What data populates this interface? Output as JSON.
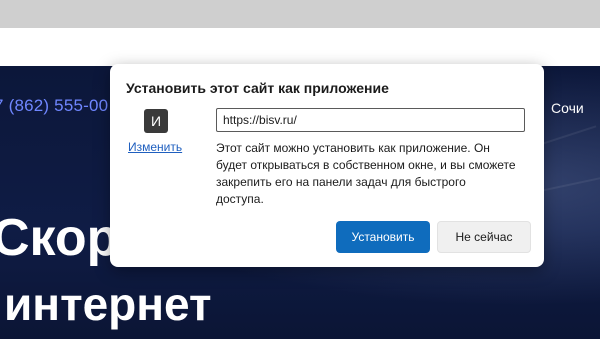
{
  "browser": {
    "top_strip_color": "#cfcfcf",
    "address_strip_color": "#ffffff"
  },
  "website": {
    "phone": "7 (862) 555-00",
    "city": "Сочи",
    "headline_line1": "Скоро",
    "headline_line2": "интернет",
    "accent_color": "#6f86ff",
    "background_color": "#0f1a3c"
  },
  "dialog": {
    "title": "Установить этот сайт как приложение",
    "app_icon_letter": "И",
    "edit_link": "Изменить",
    "url_value": "https://bisv.ru/",
    "description": "Этот сайт можно установить как приложение. Он будет открываться в собственном окне, и вы сможете закрепить его на панели задач для быстрого доступа.",
    "install_button": "Установить",
    "not_now_button": "Не сейчас",
    "primary_color": "#0f6cbd"
  }
}
